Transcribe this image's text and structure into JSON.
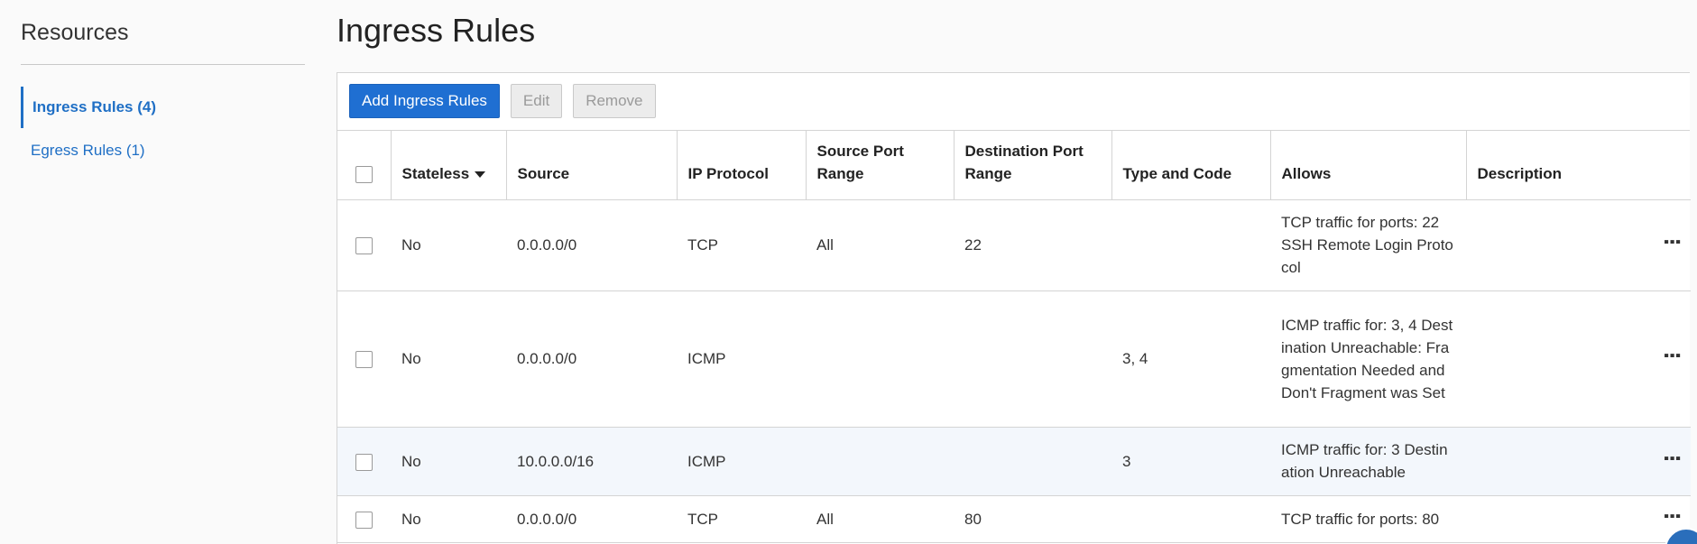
{
  "sidebar": {
    "title": "Resources",
    "items": [
      {
        "label": "Ingress Rules (4)",
        "active": true
      },
      {
        "label": "Egress Rules (1)",
        "active": false
      }
    ]
  },
  "main": {
    "title": "Ingress Rules",
    "toolbar": {
      "add_label": "Add Ingress Rules",
      "edit_label": "Edit",
      "remove_label": "Remove"
    },
    "columns": [
      "Stateless",
      "Source",
      "IP Protocol",
      "Source Port Range",
      "Destination Port Range",
      "Type and Code",
      "Allows",
      "Description"
    ],
    "rows": [
      {
        "stateless": "No",
        "source": "0.0.0.0/0",
        "protocol": "TCP",
        "src_port": "All",
        "dst_port": "22",
        "type_code": "",
        "allows": "TCP traffic for ports: 22 SSH Remote Login Protocol",
        "description": ""
      },
      {
        "stateless": "No",
        "source": "0.0.0.0/0",
        "protocol": "ICMP",
        "src_port": "",
        "dst_port": "",
        "type_code": "3, 4",
        "allows": "ICMP traffic for: 3, 4 Destination Unreachable: Fragmentation Needed and Don't Fragment was Set",
        "description": ""
      },
      {
        "stateless": "No",
        "source": "10.0.0.0/16",
        "protocol": "ICMP",
        "src_port": "",
        "dst_port": "",
        "type_code": "3",
        "allows": "ICMP traffic for: 3 Destination Unreachable",
        "description": ""
      },
      {
        "stateless": "No",
        "source": "0.0.0.0/0",
        "protocol": "TCP",
        "src_port": "All",
        "dst_port": "80",
        "type_code": "",
        "allows": "TCP traffic for ports: 80",
        "description": ""
      }
    ]
  },
  "icons": {
    "sort": "sort-desc-icon",
    "row_actions": "kebab-menu-icon",
    "help": "help-icon"
  },
  "colors": {
    "accent": "#1f6fd2",
    "link": "#1f6fc5",
    "highlight_row": "#f3f7fc"
  }
}
